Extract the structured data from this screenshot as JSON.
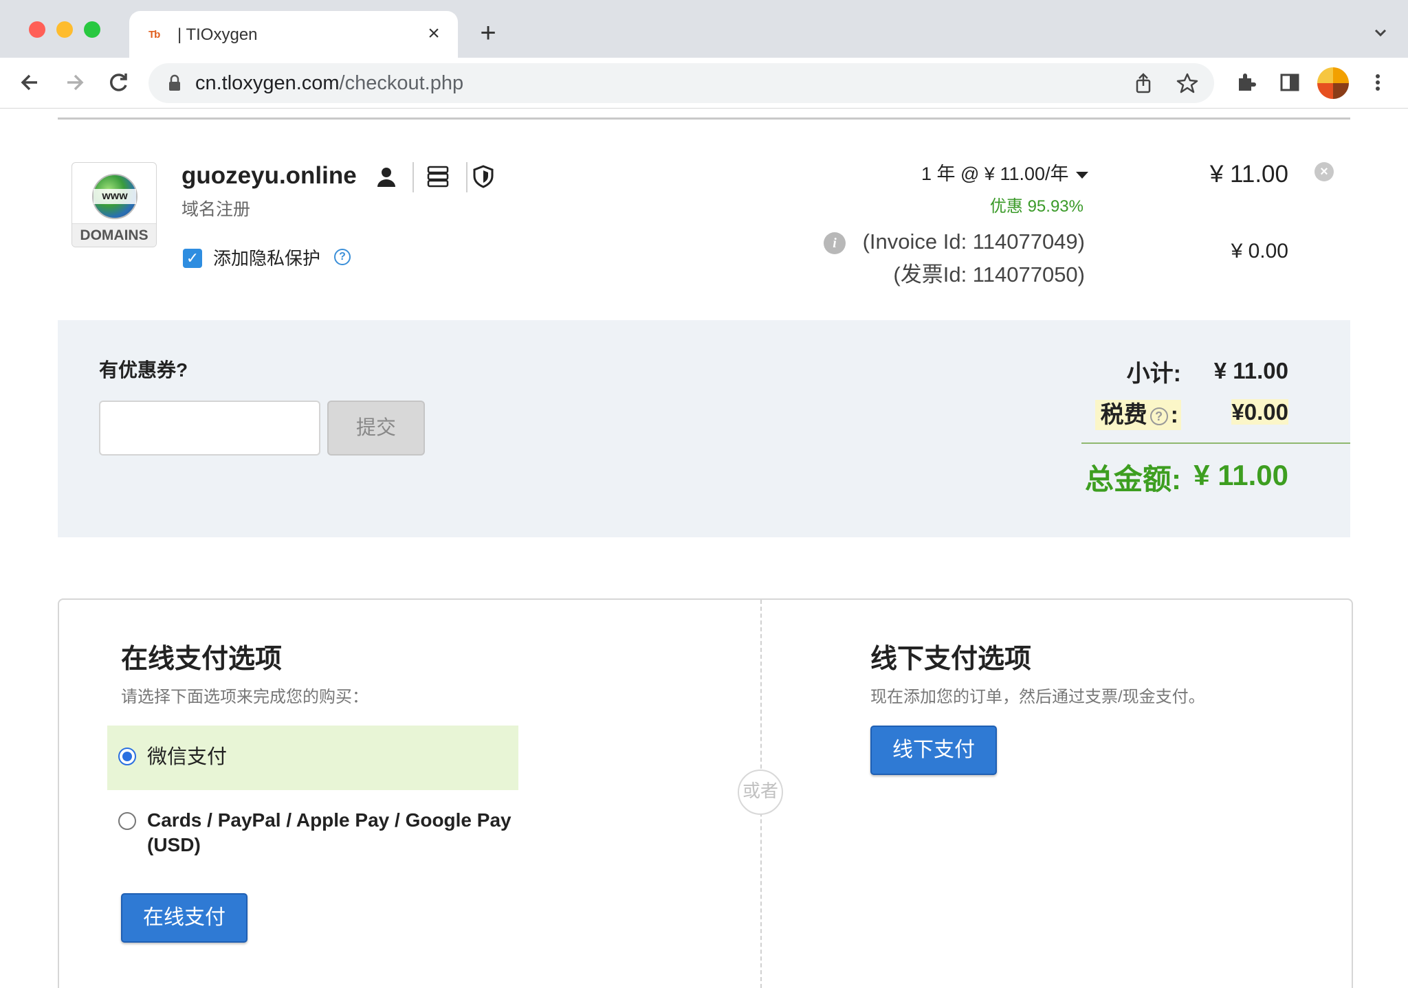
{
  "browser": {
    "tab_title": "| TIOxygen",
    "tab_favicon": "Tb",
    "url_host": "cn.tloxygen.com",
    "url_path": "/checkout.php",
    "icons": [
      "back-arrow",
      "forward-arrow",
      "reload",
      "lock",
      "share",
      "star",
      "extensions",
      "side-panel",
      "profile-avatar",
      "menu-kebab"
    ]
  },
  "cart_item": {
    "logo_text": "www",
    "logo_label": "DOMAINS",
    "domain_name": "guozeyu.online",
    "domain_type": "域名注册",
    "privacy_label": "添加隐私保护",
    "privacy_checked": true,
    "billing_cycle": "1 年 @ ¥ 11.00/年",
    "discount": "优惠 95.93%",
    "invoice_id": "(Invoice Id: 114077049)",
    "invoice_id_cn": "(发票Id: 114077050)",
    "item_price": "¥ 11.00",
    "privacy_price": "¥ 0.00"
  },
  "summary": {
    "coupon_title": "有优惠券?",
    "coupon_placeholder": "",
    "coupon_submit": "提交",
    "subtotal_label": "小计:",
    "subtotal_value": "¥ 11.00",
    "tax_label": "税费",
    "tax_colon": ":",
    "tax_value": "¥0.00",
    "total_label": "总金额:",
    "total_value": "¥ 11.00"
  },
  "payment": {
    "online_title": "在线支付选项",
    "online_subtitle": "请选择下面选项来完成您的购买：",
    "options": [
      {
        "label": "微信支付",
        "selected": true
      },
      {
        "label": "Cards / PayPal / Apple Pay / Google Pay (USD)",
        "selected": false
      }
    ],
    "online_button": "在线支付",
    "or_text": "或者",
    "offline_title": "线下支付选项",
    "offline_subtitle": "现在添加您的订单，然后通过支票/现金支付。",
    "offline_button": "线下支付"
  },
  "colors": {
    "accent_blue": "#2f7ad4",
    "discount_green": "#3a9a28",
    "total_green": "#3d9e20",
    "selected_option_bg": "#e8f5d6",
    "band_bg": "#eef2f6"
  }
}
